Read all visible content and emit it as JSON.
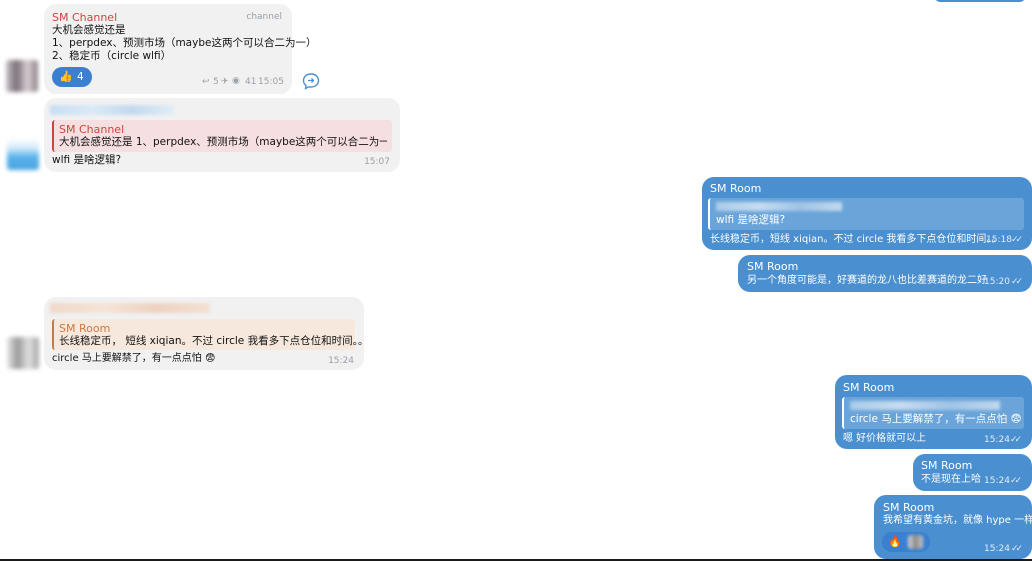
{
  "colors": {
    "incoming_bg": "#f1f1f2",
    "outgoing_bg": "#4a8fcf",
    "sender_red": "#c9473f",
    "reaction_bg": "#3a7fd0"
  },
  "messages": {
    "m1": {
      "sender": "SM Channel",
      "tag": "channel",
      "lines": [
        "大机会感觉还是",
        "1、perpdex、预测市场（maybe这两个可以合二为一）",
        "2、稳定币（circle wlfi）"
      ],
      "reaction_emoji": "👍",
      "reaction_count": "4",
      "replies": "5",
      "views": "41",
      "time": "15:05"
    },
    "m2": {
      "quote_sender": "SM Channel",
      "quote_text": "大机会感觉还是 1、perpdex、预测市场（maybe这两个可以合二为一...",
      "text": "wlfi 是啥逻辑?",
      "time": "15:07"
    },
    "m3": {
      "sender": "SM Room",
      "quote_text": "wlfi 是啥逻辑?",
      "text": "长线稳定币，短线 xiqian。不过 circle 我看多下点仓位和时间。。",
      "time": "15:18"
    },
    "m4": {
      "sender": "SM Room",
      "text": "另一个角度可能是，好赛道的龙八也比差赛道的龙二好",
      "time": "15:20"
    },
    "m5": {
      "quote_sender": "SM Room",
      "quote_text": "长线稳定币， 短线 xiqian。不过 circle 我看多下点仓位和时间。。",
      "text": "circle 马上要解禁了，有一点点怕 😨",
      "time": "15:24"
    },
    "m6": {
      "sender": "SM Room",
      "quote_text": "circle 马上要解禁了，有一点点怕 😨",
      "text": "嗯 好价格就可以上",
      "time": "15:24"
    },
    "m7": {
      "sender": "SM Room",
      "text": "不是现在上哈",
      "time": "15:24"
    },
    "m8": {
      "sender": "SM Room",
      "text": "我希望有黄金坑，就像 hype 一样",
      "reaction_emoji": "🔥",
      "time": "15:24"
    }
  }
}
